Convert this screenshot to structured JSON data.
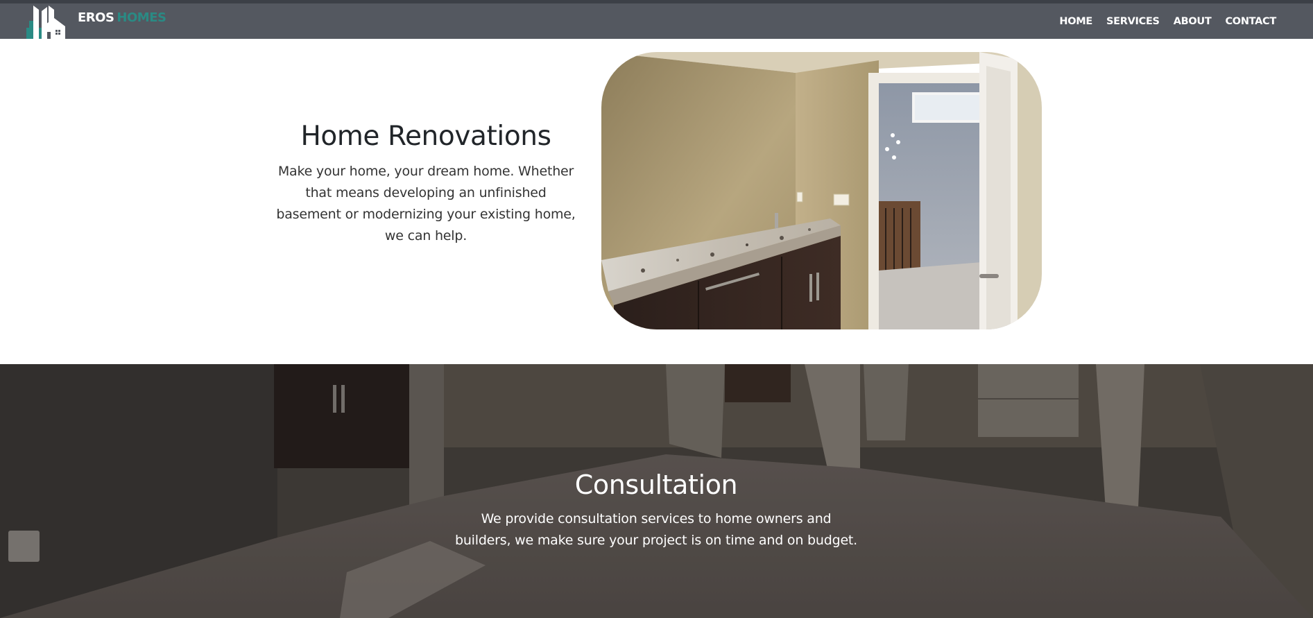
{
  "brand": {
    "name_part1": "EROS",
    "name_part2": "HOMES",
    "accent_color": "#2a8a84",
    "logo_icon": "house-skyline-icon"
  },
  "nav": {
    "items": [
      {
        "label": "HOME"
      },
      {
        "label": "SERVICES"
      },
      {
        "label": "ABOUT"
      },
      {
        "label": "CONTACT"
      }
    ],
    "background": "#545860"
  },
  "renovations": {
    "title": "Home Renovations",
    "body": "Make your home, your dream home. Whether that means developing an unfinished basement or modernizing your existing home, we can help.",
    "photo_icon": "bathroom-vanity-photo"
  },
  "consultation": {
    "title": "Consultation",
    "body": "We provide consultation services to home owners and builders, we make sure your project is on time and on budget.",
    "background_icon": "carpeted-room-photo"
  }
}
